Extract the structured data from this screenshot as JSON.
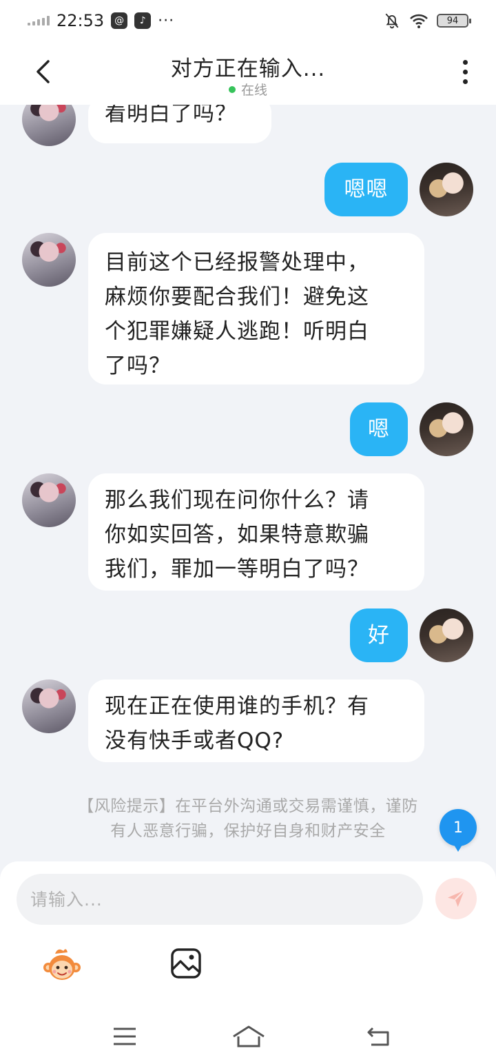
{
  "status_bar": {
    "time": "22:53",
    "battery": "94"
  },
  "header": {
    "title": "对方正在输入...",
    "status": "在线"
  },
  "messages": [
    {
      "side": "left",
      "lines": [
        "看明白了吗？"
      ]
    },
    {
      "side": "right",
      "lines": [
        "嗯嗯"
      ]
    },
    {
      "side": "left",
      "lines": [
        "目前这个已经报警处理中，",
        "麻烦你要配合我们！避免这",
        "个犯罪嫌疑人逃跑！听明白",
        "了吗？"
      ]
    },
    {
      "side": "right",
      "lines": [
        "嗯"
      ]
    },
    {
      "side": "left",
      "lines": [
        "那么我们现在问你什么？请",
        "你如实回答，如果特意欺骗",
        "我们，罪加一等明白了吗？"
      ]
    },
    {
      "side": "right",
      "lines": [
        "好"
      ]
    },
    {
      "side": "left",
      "lines": [
        "现在正在使用谁的手机？有",
        "没有快手或者QQ?"
      ]
    }
  ],
  "risk_tip": {
    "line1": "【风险提示】在平台外沟通或交易需谨慎，谨防",
    "line2": "有人恶意行骗，保护好自身和财产安全"
  },
  "unread_badge": "1",
  "input": {
    "placeholder": "请输入..."
  },
  "colors": {
    "accent": "#2ab4f5",
    "background": "#f1f3f7",
    "online": "#37c35b",
    "send_button": "#fde6e3"
  }
}
